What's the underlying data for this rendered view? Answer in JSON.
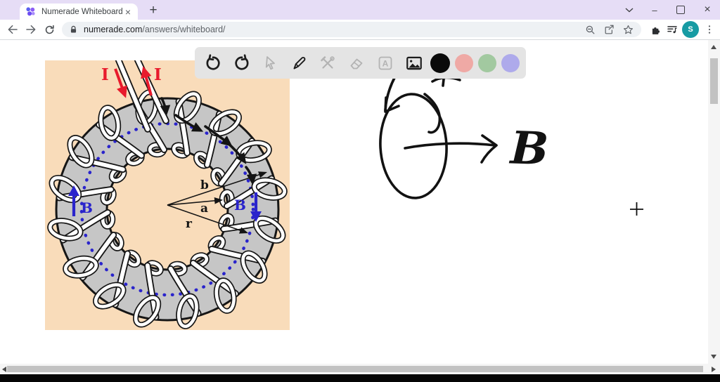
{
  "browser": {
    "tab": {
      "title": "Numerade Whiteboard",
      "close_glyph": "×",
      "new_tab_glyph": "+"
    },
    "window": {
      "minimize_glyph": "–",
      "close_glyph": "×"
    },
    "address": {
      "domain": "numerade.com",
      "path": "/answers/whiteboard/"
    },
    "profile": {
      "avatar_letter": "S"
    }
  },
  "wb_toolbar": {
    "text_tool_glyph": "A",
    "swatch_colors": {
      "black": "#0a0a0a",
      "red": "#efa9a5",
      "green": "#a2c9a0",
      "purple": "#aeaaeb"
    }
  },
  "figure": {
    "current_left": "I",
    "current_right": "I",
    "field_left": "B",
    "field_right": "B",
    "radius_outer": "b",
    "radius_inner": "a",
    "radius_mid": "r"
  },
  "sketch": {
    "field_label": "B"
  }
}
